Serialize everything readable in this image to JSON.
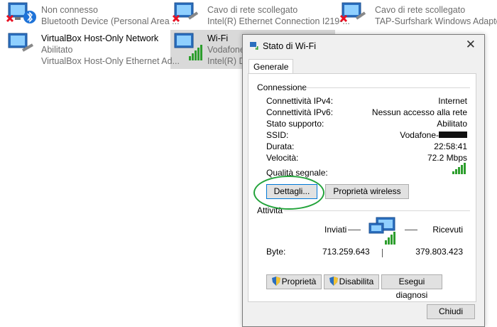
{
  "connections": [
    {
      "name": "",
      "status": "Non connesso",
      "device": "Bluetooth Device (Personal Area ..."
    },
    {
      "name": "",
      "status": "Cavo di rete scollegato",
      "device": "Intel(R) Ethernet Connection I219-..."
    },
    {
      "name": "",
      "status": "Cavo di rete scollegato",
      "device": "TAP-Surfshark Windows Adapter ..."
    },
    {
      "name": "VirtualBox Host-Only Network",
      "status": "Abilitato",
      "device": "VirtualBox Host-Only Ethernet Ad..."
    },
    {
      "name": "Wi-Fi",
      "status": "Vodafone",
      "device": "Intel(R) Du"
    }
  ],
  "dialog": {
    "title": "Stato di Wi-Fi",
    "tab": "Generale",
    "connection_group": "Connessione",
    "rows": [
      {
        "label": "Connettività IPv4:",
        "value": "Internet"
      },
      {
        "label": "Connettività IPv6:",
        "value": "Nessun accesso alla rete"
      },
      {
        "label": "Stato supporto:",
        "value": "Abilitato"
      },
      {
        "label": "SSID:",
        "value": "Vodafone-"
      },
      {
        "label": "Durata:",
        "value": "22:58:41"
      },
      {
        "label": "Velocità:",
        "value": "72.2 Mbps"
      }
    ],
    "signal_label": "Qualità segnale:",
    "details_button": "Dettagli...",
    "wireless_props_button": "Proprietà wireless",
    "activity_group": "Attività",
    "sent_label": "Inviati",
    "received_label": "Ricevuti",
    "bytes_label": "Byte:",
    "bytes_sent": "713.259.643",
    "bytes_received": "379.803.423",
    "properties_button": "Proprietà",
    "disable_button": "Disabilita",
    "diagnose_button": "Esegui diagnosi",
    "close_button": "Chiudi"
  },
  "colors": {
    "accent": "#0078d7",
    "highlight_ring": "#22a33a",
    "signal": "#2d9e2d",
    "disconnected": "#e81123"
  }
}
